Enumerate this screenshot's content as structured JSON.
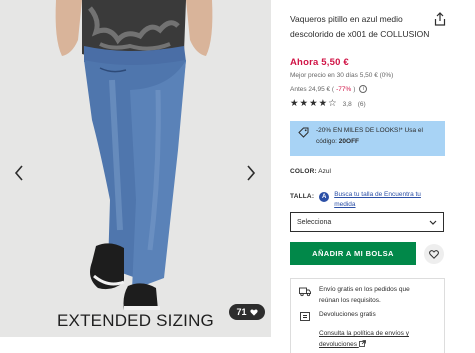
{
  "product": {
    "title": "Vaqueros pitillo en azul medio descolorido de x001 de COLLUSION",
    "price_now": "Ahora 5,50 €",
    "best_price": "Mejor precio en 30 días 5,50 € (0%)",
    "before_prefix": "Antes 24,95 € (",
    "before_pct": "-77%",
    "before_suffix": ")",
    "info_glyph": "i"
  },
  "rating": {
    "stars": 4,
    "max_stars": 5,
    "score": "3,8",
    "count": "(6)"
  },
  "promo": {
    "text": "-20% EN MILES DE LOOKS!* Usa el código: ",
    "code": "20OFF"
  },
  "color": {
    "label": "COLOR:",
    "value": "Azul"
  },
  "size": {
    "label": "TALLA:",
    "fit_link": "Busca tu talla de Encuentra tu medida",
    "fit_badge": "A",
    "select_value": "Selecciona"
  },
  "actions": {
    "add_to_bag": "AÑADIR A MI BOLSA"
  },
  "shipping": {
    "delivery": "Envío gratis en los pedidos que reúnan los requisitos.",
    "returns": "Devoluciones gratis",
    "policy_link": "Consulta la política de envíos y devoluciones"
  },
  "gallery": {
    "overlay_text": "EXTENDED SIZING",
    "save_count": "71",
    "background": "#e7e7e6"
  },
  "colors": {
    "price": "#d01345",
    "cta": "#018849",
    "promo": "#a8d3f5",
    "link": "#2b4fa6"
  },
  "icons": [
    "chevron-left-icon",
    "chevron-right-icon",
    "share-icon",
    "tag-icon",
    "truck-icon",
    "returns-icon",
    "heart-icon"
  ]
}
